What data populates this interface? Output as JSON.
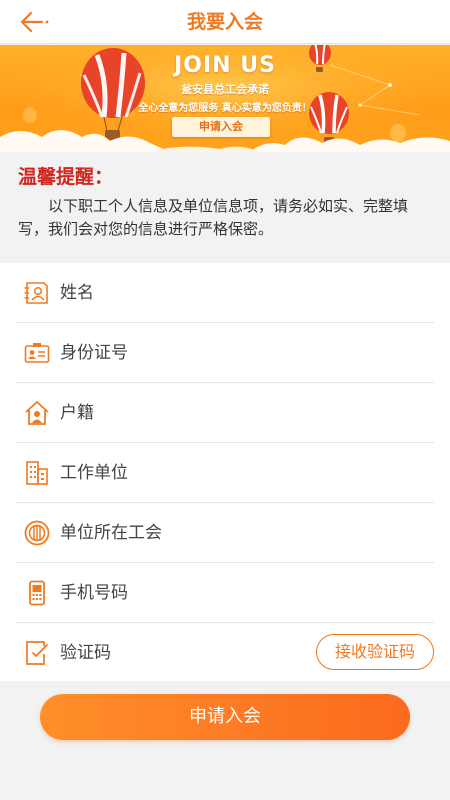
{
  "header": {
    "title": "我要入会",
    "back_icon": "back-arrow-icon"
  },
  "banner": {
    "headline": "JOIN US",
    "subheadline": "瓮安县总工会承诺",
    "slogan": "全心全意为您服务  真心实意为您负责！",
    "button_label": "申请入会"
  },
  "notice": {
    "title": "温馨提醒：",
    "text": "以下职工个人信息及单位信息项，请务必如实、完整填写，我们会对您的信息进行严格保密。"
  },
  "form": {
    "fields": [
      {
        "label": "姓名",
        "icon": "id-card-person-icon"
      },
      {
        "label": "身份证号",
        "icon": "id-badge-icon"
      },
      {
        "label": "户籍",
        "icon": "house-person-icon"
      },
      {
        "label": "工作单位",
        "icon": "building-icon"
      },
      {
        "label": "单位所在工会",
        "icon": "union-emblem-icon"
      },
      {
        "label": "手机号码",
        "icon": "phone-icon"
      },
      {
        "label": "验证码",
        "icon": "edit-document-icon"
      }
    ],
    "get_code_label": "接收验证码"
  },
  "submit": {
    "label": "申请入会"
  },
  "colors": {
    "accent": "#f07a22",
    "warning_title": "#d2271f",
    "button_start": "#ff8f2a",
    "button_end": "#fb6a1e"
  }
}
